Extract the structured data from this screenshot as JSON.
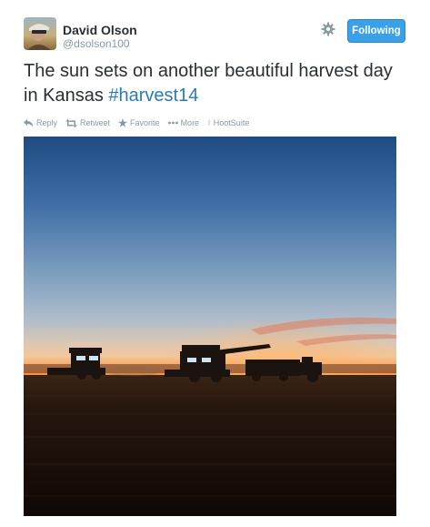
{
  "user": {
    "display_name": "David Olson",
    "screen_name": "@dsolson100",
    "avatar_icon": "user-avatar"
  },
  "follow_button": {
    "label": "Following",
    "color": "#3aa1e8"
  },
  "settings": {
    "icon": "gear-icon"
  },
  "tweet": {
    "text_main": "The sun sets on another beautiful harvest day in Kansas ",
    "hashtag": "#harvest14",
    "hashtag_color": "#2b7bb9"
  },
  "actions": {
    "reply": "Reply",
    "retweet": "Retweet",
    "favorite": "Favorite",
    "more": "More",
    "hootsuite": "HootSuite"
  },
  "photo": {
    "subject": "combine harvesters silhouetted against sunset over a wheat field"
  }
}
